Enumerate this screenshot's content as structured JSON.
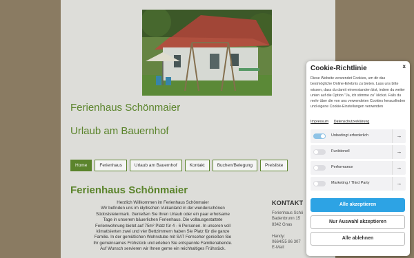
{
  "site": {
    "title": "Ferienhaus Schönmaier",
    "subtitle": "Urlaub am Bauernhof"
  },
  "nav": {
    "items": [
      {
        "label": "Home",
        "active": true
      },
      {
        "label": "Ferienhaus",
        "active": false
      },
      {
        "label": "Urlaub am Bauernhof",
        "active": false
      },
      {
        "label": "Kontakt",
        "active": false
      },
      {
        "label": "Buchen/Belegung",
        "active": false
      },
      {
        "label": "Preisliste",
        "active": false
      }
    ]
  },
  "main": {
    "heading": "Ferienhaus Schönmaier",
    "intro_lines": [
      "Herzlich Willkommen im Ferienhaus Schönmaier",
      "Wir befinden uns im idyllischen Vulkanland in der wunderschönen",
      "Südoststeiermark. Genießen Sie Ihren Urlaub oder ein paar erholsame",
      "Tage in unserem bäuerlichen Ferienhaus. Die vollausgestattete",
      "Ferienwohnung bietet auf 75m² Platz für 4 - 6 Personen. In unseren voll",
      "klimatisierten zwei und vier Bettzimmern haben Sie Platz für die ganze",
      "Familie. In der gemütlichen Wohnstube mit SAT Fernseher genießen Sie",
      "Ihr gemeinsames Frühstück und erleben Sie entspannte Familienabende.",
      "Auf Wunsch servieren wir Ihnen gerne ein reichhaltiges Frühstück."
    ]
  },
  "contact": {
    "heading": "KONTAKT",
    "lines": [
      "Ferienhaus Schö",
      "Badenbrunn 15",
      "8342 Gnas",
      "",
      "Handy:",
      "0664/55 86 307",
      "E-Mail:"
    ]
  },
  "cookie": {
    "title": "Cookie-Richtlinie",
    "close_label": "x",
    "text": "Diese Website verwendet Cookies, um dir das bestmögliche Online-Erlebnis zu bieten. Lass uns bitte wissen, dass du damit einverstanden bist, indem du weiter unten auf die Option \"Ja, ich stimme zu\" klickst. Falls du mehr über die von uns verwendeten Cookies herausfinden und eigene Cookie-Einstellungen verwenden",
    "links": [
      "Impressum",
      "Datenschutzerklärung"
    ],
    "categories": [
      {
        "label": "Unbedingt erforderlich",
        "enabled": true
      },
      {
        "label": "Funktionell",
        "enabled": false
      },
      {
        "label": "Performance",
        "enabled": false
      },
      {
        "label": "Marketing / Third Party",
        "enabled": false
      }
    ],
    "arrow": "→",
    "buttons": {
      "accept_all": "Alle akzeptieren",
      "accept_selection": "Nur Auswahl akzeptieren",
      "reject_all": "Alle ablehnen"
    },
    "accent_color": "#2da3e4"
  },
  "colors": {
    "brand_green": "#5f8a2e",
    "background": "#8a7b62"
  }
}
